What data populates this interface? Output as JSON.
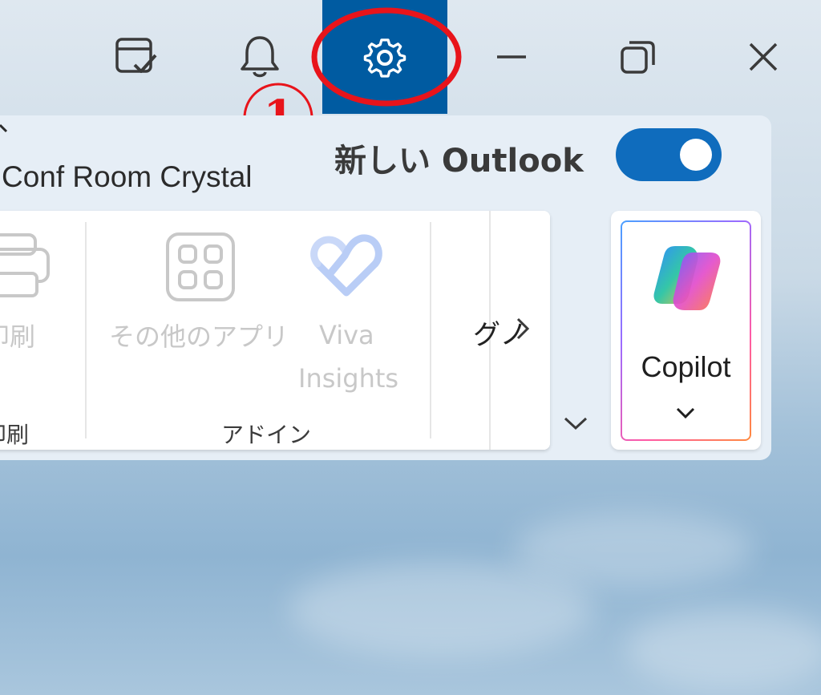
{
  "titlebar": {
    "icons": [
      "calendar-check-icon",
      "bell-icon",
      "gear-icon",
      "minimize-icon",
      "restore-icon",
      "close-icon"
    ],
    "settings_active_color": "#005ba1"
  },
  "annotation": {
    "step_number": "1",
    "color": "#e8141b"
  },
  "header": {
    "room_text": "Conf Room Crystal",
    "new_outlook_label": "新しい Outlook",
    "toggle_on": true,
    "toggle_color": "#0f6cbd"
  },
  "ribbon": {
    "print_button_label": "印刷",
    "print_group_label": "印刷",
    "other_apps_label": "その他のアプリ",
    "viva_label_line1": "Viva",
    "viva_label_line2": "Insights",
    "addins_group_label": "アドイン",
    "gu_label": "グノ",
    "more_icon": "chevron-right-icon",
    "collapse_icon": "chevron-down-icon"
  },
  "copilot": {
    "label": "Copilot",
    "icon": "copilot-logo-icon"
  }
}
